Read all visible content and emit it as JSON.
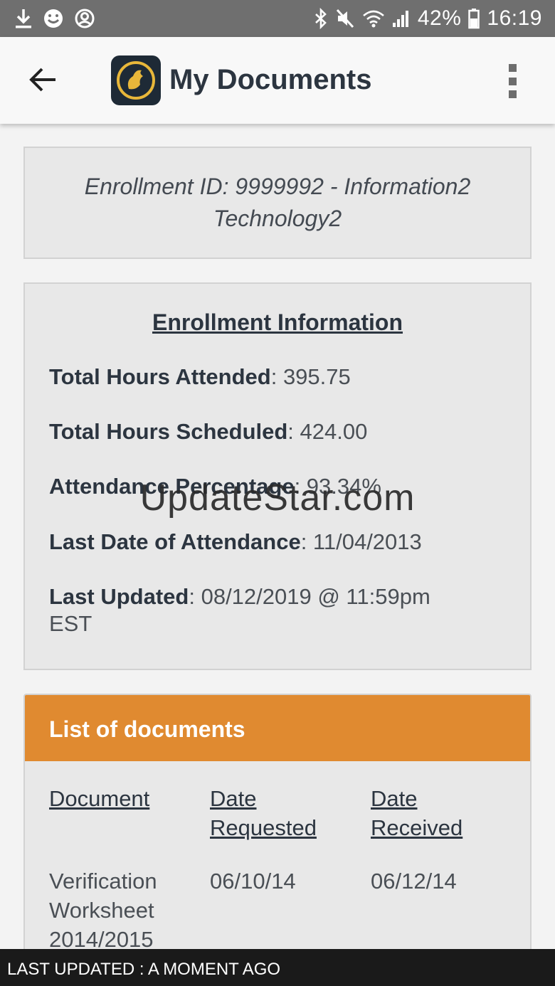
{
  "status_bar": {
    "battery": "42%",
    "time": "16:19",
    "left_icons": [
      "download-icon",
      "face-icon",
      "account-circle-icon"
    ],
    "right_icons": [
      "bluetooth-icon",
      "mute-icon",
      "wifi-icon",
      "signal-icon",
      "battery-icon"
    ]
  },
  "app_bar": {
    "title": "My Documents",
    "back_icon": "arrow-back-icon",
    "logo_icon": "app-logo-icon",
    "menu_icon": "more-vert-icon"
  },
  "enrollment": {
    "id_text": "Enrollment ID: 9999992 - Information2 Technology2"
  },
  "info": {
    "heading": "Enrollment Information",
    "rows": [
      {
        "label": "Total Hours Attended",
        "value": ": 395.75"
      },
      {
        "label": "Total Hours Scheduled",
        "value": ": 424.00"
      },
      {
        "label": "Attendance Percentage",
        "value": ": 93.34%"
      },
      {
        "label": "Last Date of Attendance",
        "value": ": 11/04/2013"
      },
      {
        "label": "Last Updated",
        "value": ": 08/12/2019 @ 11:59pm EST"
      }
    ]
  },
  "documents": {
    "header": "List of documents",
    "columns": [
      "Document",
      "Date Requested",
      "Date Received"
    ],
    "rows": [
      {
        "document": "Verification Worksheet 2014/2015",
        "requested": "06/10/14",
        "received": "06/12/14"
      }
    ]
  },
  "watermark": "UpdateStar.com",
  "snackbar": "LAST UPDATED : A MOMENT AGO",
  "colors": {
    "status_bar": "#6f6f6f",
    "accent_orange": "#e08a30",
    "card_bg": "#e8e8e8",
    "text_dark": "#2c3540"
  }
}
